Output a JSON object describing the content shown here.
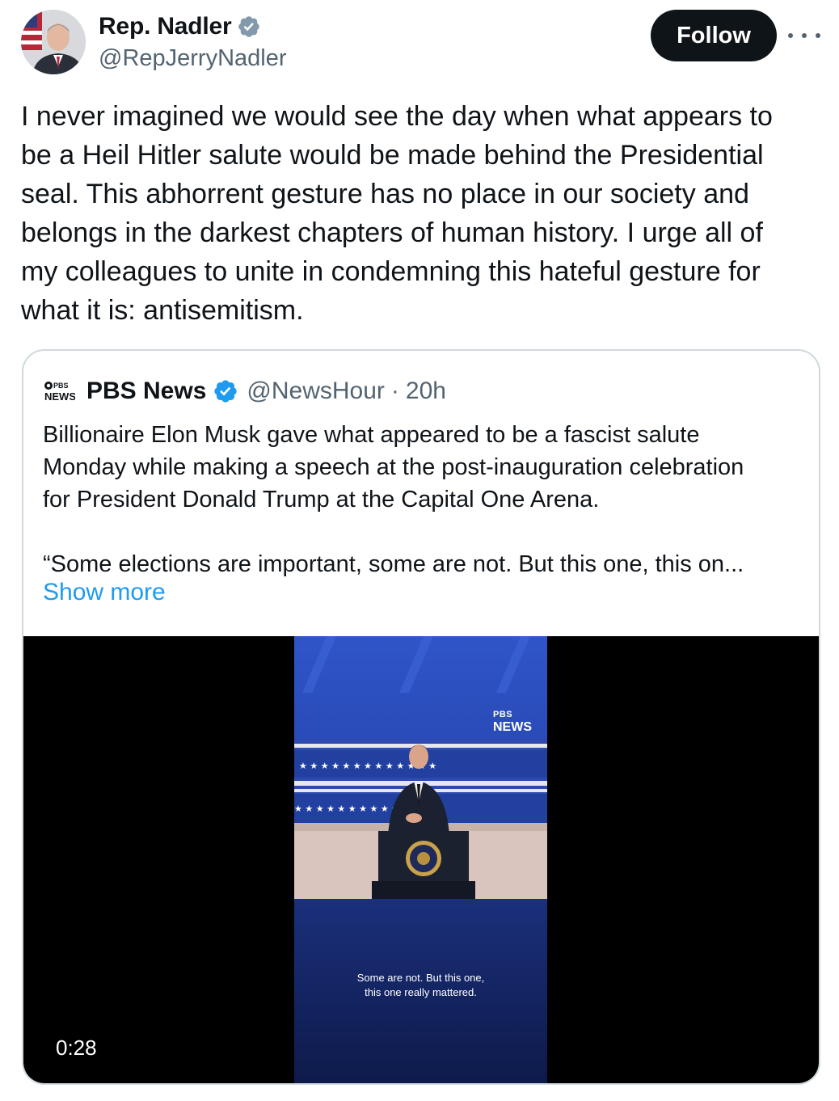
{
  "author": {
    "display_name": "Rep. Nadler",
    "handle": "@RepJerryNadler",
    "verified_icon": "verified-badge-icon",
    "verified_color": "#829aab"
  },
  "actions": {
    "follow_label": "Follow"
  },
  "tweet": {
    "text": "I never imagined we would see the day when what appears to\nbe a Heil Hitler salute would be made behind the Presidential\nseal. This abhorrent gesture has no place in our society and\nbelongs in the darkest chapters of human history. I urge all of\nmy colleagues to unite in condemning this hateful gesture for\nwhat it is: antisemitism."
  },
  "quote": {
    "logo_line1": "PBS",
    "logo_line2": "NEWS",
    "display_name": "PBS News",
    "handle": "@NewsHour",
    "separator": "·",
    "time": "20h",
    "verified_color": "#1d9bf0",
    "text": "Billionaire Elon Musk gave what appeared to be a fascist salute\nMonday while making a speech at the post-inauguration celebration\nfor President Donald Trump at the Capital One Arena.\n\n“Some elections are important, some are not. But this one, this on...",
    "show_more": "Show more",
    "video": {
      "caption": "Some are not. But this one,\nthis one really mattered.",
      "logo_line1": "PBS",
      "logo_line2": "NEWS",
      "duration": "0:28"
    }
  }
}
